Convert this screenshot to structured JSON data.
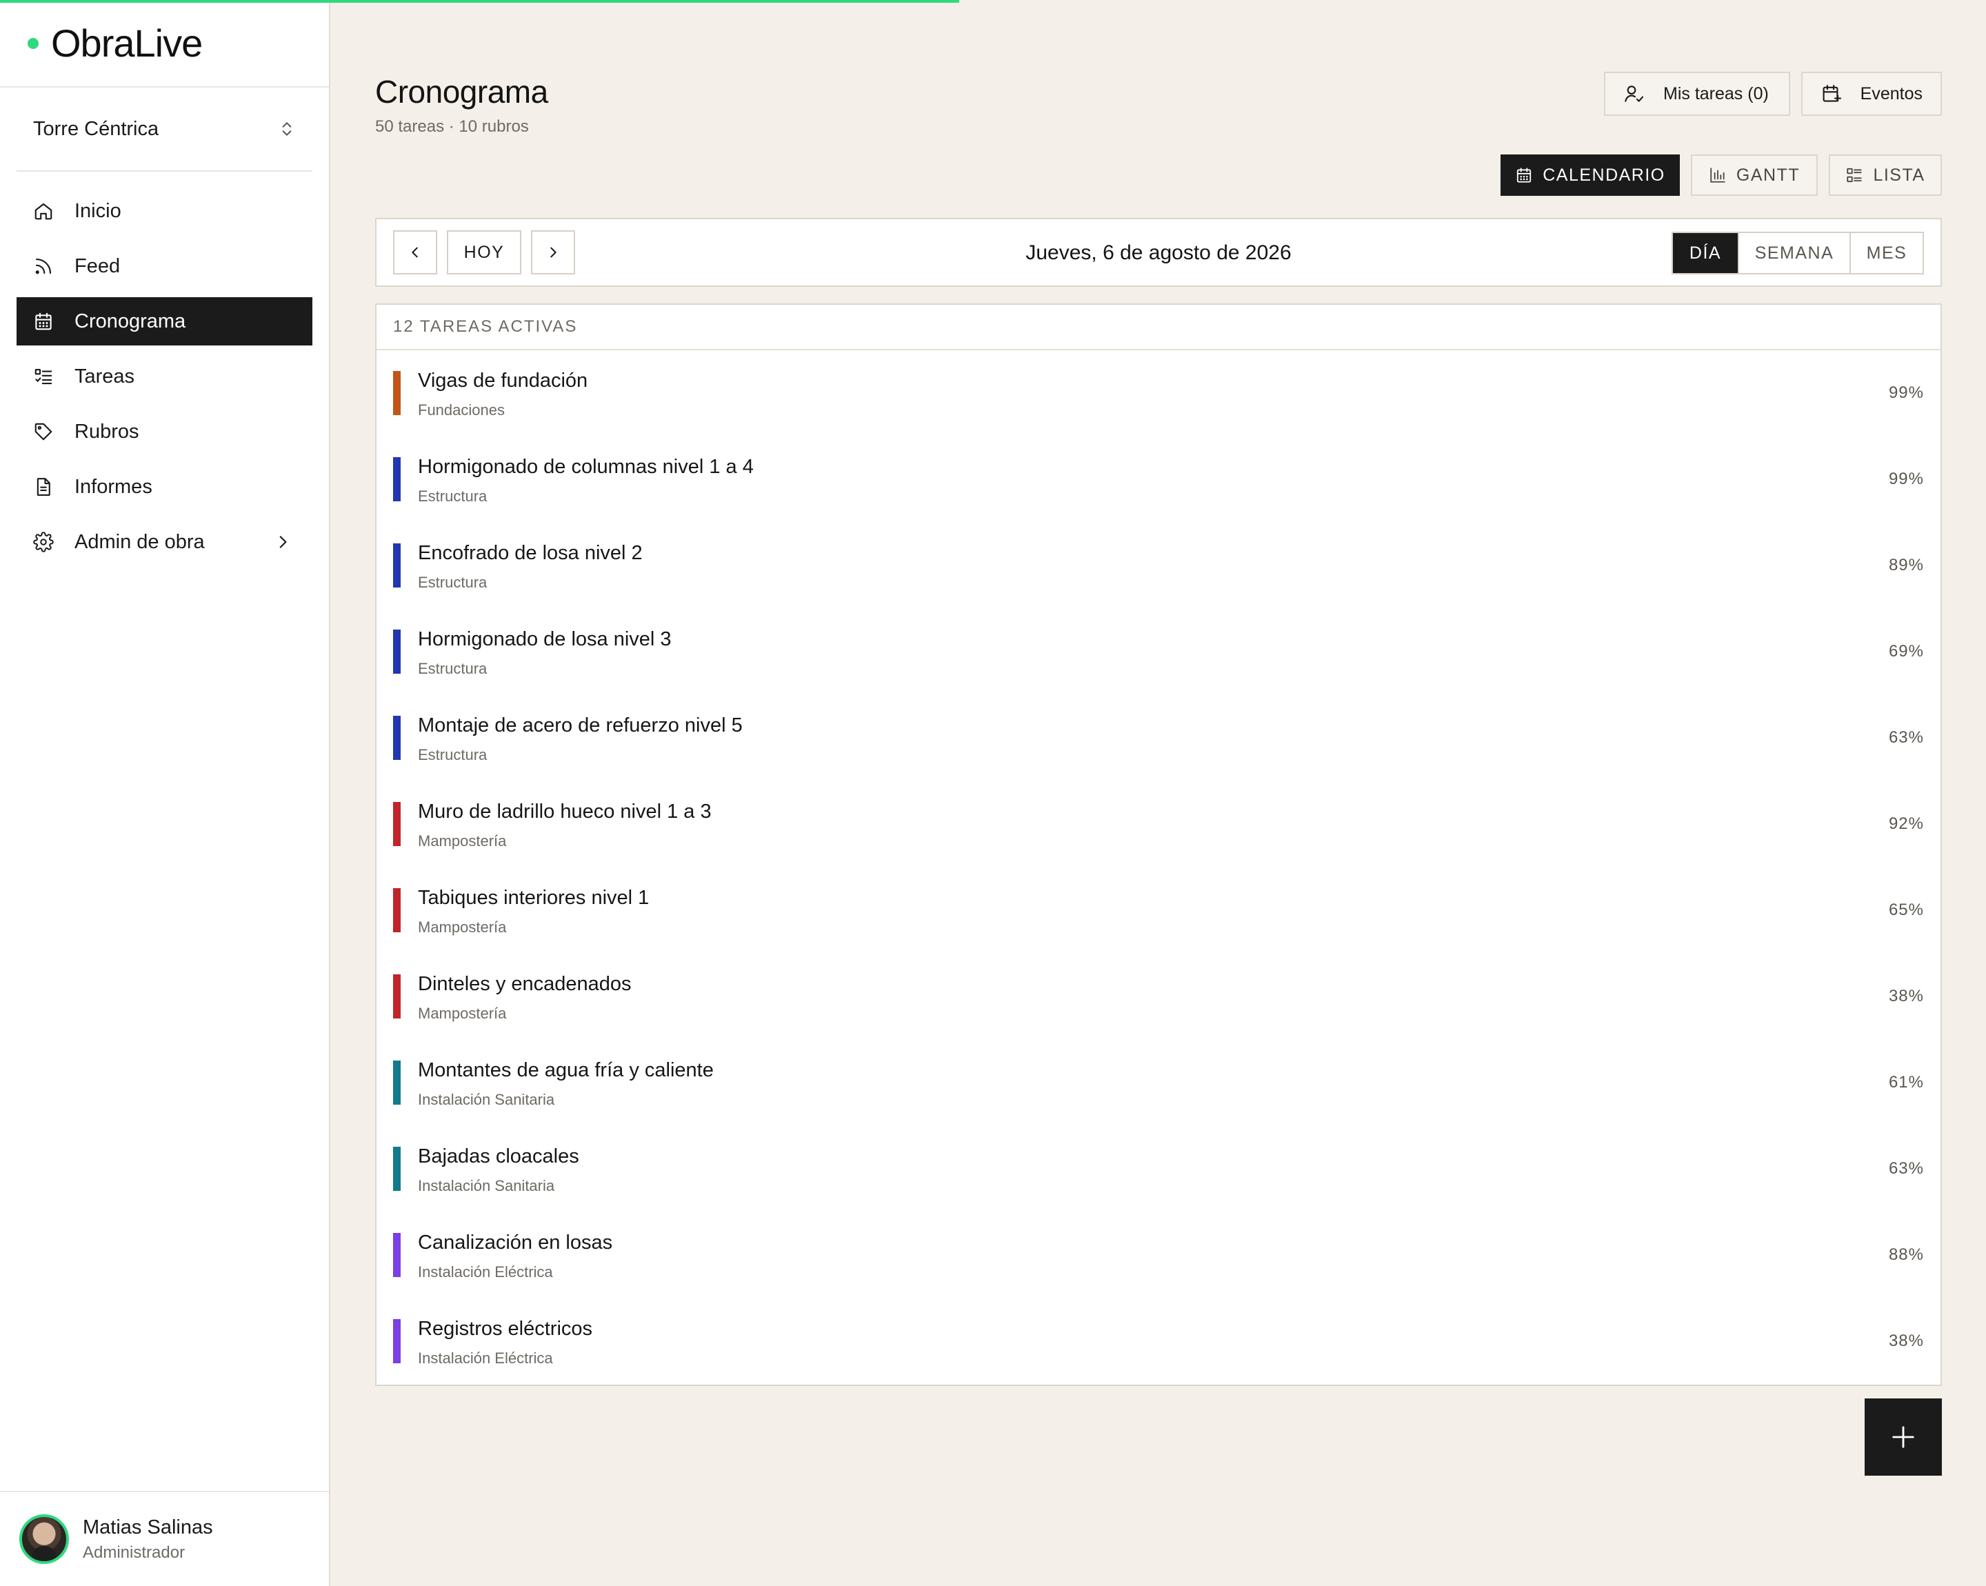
{
  "app": {
    "name": "ObraLive",
    "accent": "#2fd97e",
    "load_progress": 0.483
  },
  "sidebar": {
    "project": "Torre Céntrica",
    "items": [
      {
        "label": "Inicio",
        "icon": "home-icon"
      },
      {
        "label": "Feed",
        "icon": "rss-icon"
      },
      {
        "label": "Cronograma",
        "icon": "calendar-icon",
        "active": true
      },
      {
        "label": "Tareas",
        "icon": "list-checks-icon"
      },
      {
        "label": "Rubros",
        "icon": "tag-icon"
      },
      {
        "label": "Informes",
        "icon": "document-icon"
      },
      {
        "label": "Admin de obra",
        "icon": "gear-icon",
        "has_submenu": true
      }
    ],
    "user": {
      "name": "Matias Salinas",
      "role": "Administrador"
    }
  },
  "header": {
    "title": "Cronograma",
    "subtitle": "50 tareas · 10 rubros",
    "my_tasks_label": "Mis tareas (0)",
    "events_label": "Eventos"
  },
  "views": {
    "calendar": "CALENDARIO",
    "gantt": "GANTT",
    "list": "LISTA",
    "active": "CALENDARIO"
  },
  "date_nav": {
    "today_label": "HOY",
    "current_date": "Jueves, 6 de agosto de 2026",
    "modes": [
      "DÍA",
      "SEMANA",
      "MES"
    ],
    "active_mode": "DÍA"
  },
  "tasks": {
    "header": "12 TAREAS ACTIVAS",
    "items": [
      {
        "name": "Vigas de fundación",
        "category": "Fundaciones",
        "percent": "99%",
        "color": "#c2551a"
      },
      {
        "name": "Hormigonado de columnas nivel 1 a 4",
        "category": "Estructura",
        "percent": "99%",
        "color": "#2238b0"
      },
      {
        "name": "Encofrado de losa nivel 2",
        "category": "Estructura",
        "percent": "89%",
        "color": "#2238b0"
      },
      {
        "name": "Hormigonado de losa nivel 3",
        "category": "Estructura",
        "percent": "69%",
        "color": "#2238b0"
      },
      {
        "name": "Montaje de acero de refuerzo nivel 5",
        "category": "Estructura",
        "percent": "63%",
        "color": "#2238b0"
      },
      {
        "name": "Muro de ladrillo hueco nivel 1 a 3",
        "category": "Mampostería",
        "percent": "92%",
        "color": "#c0252a"
      },
      {
        "name": "Tabiques interiores nivel 1",
        "category": "Mampostería",
        "percent": "65%",
        "color": "#c0252a"
      },
      {
        "name": "Dinteles y encadenados",
        "category": "Mampostería",
        "percent": "38%",
        "color": "#c0252a"
      },
      {
        "name": "Montantes de agua fría y caliente",
        "category": "Instalación Sanitaria",
        "percent": "61%",
        "color": "#137a8c"
      },
      {
        "name": "Bajadas cloacales",
        "category": "Instalación Sanitaria",
        "percent": "63%",
        "color": "#137a8c"
      },
      {
        "name": "Canalización en losas",
        "category": "Instalación Eléctrica",
        "percent": "88%",
        "color": "#7b3fe4"
      },
      {
        "name": "Registros eléctricos",
        "category": "Instalación Eléctrica",
        "percent": "38%",
        "color": "#7b3fe4"
      }
    ]
  }
}
